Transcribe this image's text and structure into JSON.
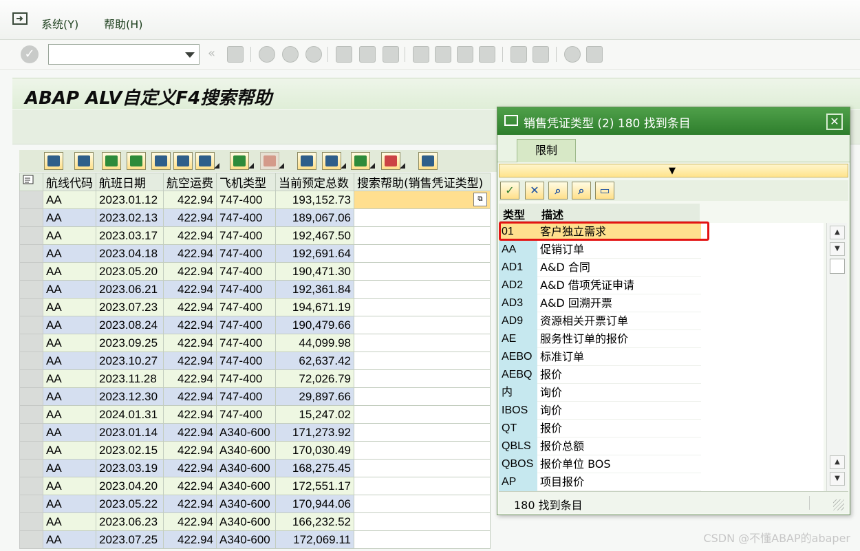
{
  "menubar": {
    "items": [
      {
        "label": "系统(Y)"
      },
      {
        "label": "帮助(H)"
      }
    ]
  },
  "toolbar": {
    "command_field": {
      "value": "",
      "placeholder": ""
    }
  },
  "title": "ABAP ALV自定义F4搜索帮助",
  "grid": {
    "columns": [
      "航线代码",
      "航班日期",
      "航空运费",
      "飞机类型",
      "当前预定总数",
      "搜索帮助(销售凭证类型)"
    ],
    "rows": [
      [
        "AA",
        "2023.01.12",
        "422.94",
        "747-400",
        "193,152.73",
        ""
      ],
      [
        "AA",
        "2023.02.13",
        "422.94",
        "747-400",
        "189,067.06",
        ""
      ],
      [
        "AA",
        "2023.03.17",
        "422.94",
        "747-400",
        "192,467.50",
        ""
      ],
      [
        "AA",
        "2023.04.18",
        "422.94",
        "747-400",
        "192,691.64",
        ""
      ],
      [
        "AA",
        "2023.05.20",
        "422.94",
        "747-400",
        "190,471.30",
        ""
      ],
      [
        "AA",
        "2023.06.21",
        "422.94",
        "747-400",
        "192,361.84",
        ""
      ],
      [
        "AA",
        "2023.07.23",
        "422.94",
        "747-400",
        "194,671.19",
        ""
      ],
      [
        "AA",
        "2023.08.24",
        "422.94",
        "747-400",
        "190,479.66",
        ""
      ],
      [
        "AA",
        "2023.09.25",
        "422.94",
        "747-400",
        "44,099.98",
        ""
      ],
      [
        "AA",
        "2023.10.27",
        "422.94",
        "747-400",
        "62,637.42",
        ""
      ],
      [
        "AA",
        "2023.11.28",
        "422.94",
        "747-400",
        "72,026.79",
        ""
      ],
      [
        "AA",
        "2023.12.30",
        "422.94",
        "747-400",
        "29,897.66",
        ""
      ],
      [
        "AA",
        "2024.01.31",
        "422.94",
        "747-400",
        "15,247.02",
        ""
      ],
      [
        "AA",
        "2023.01.14",
        "422.94",
        "A340-600",
        "171,273.92",
        ""
      ],
      [
        "AA",
        "2023.02.15",
        "422.94",
        "A340-600",
        "170,030.49",
        ""
      ],
      [
        "AA",
        "2023.03.19",
        "422.94",
        "A340-600",
        "168,275.45",
        ""
      ],
      [
        "AA",
        "2023.04.20",
        "422.94",
        "A340-600",
        "172,551.17",
        ""
      ],
      [
        "AA",
        "2023.05.22",
        "422.94",
        "A340-600",
        "170,944.06",
        ""
      ],
      [
        "AA",
        "2023.06.23",
        "422.94",
        "A340-600",
        "166,232.52",
        ""
      ],
      [
        "AA",
        "2023.07.25",
        "422.94",
        "A340-600",
        "172,069.11",
        ""
      ]
    ]
  },
  "popup": {
    "title": "销售凭证类型 (2)  180 找到条目",
    "tab_label": "限制",
    "filter_icon": "▼",
    "headers": {
      "type": "类型",
      "desc": "描述"
    },
    "items": [
      {
        "type": "01",
        "desc": "客户独立需求"
      },
      {
        "type": "AA",
        "desc": "促销订单"
      },
      {
        "type": "AD1",
        "desc": "A&D 合同"
      },
      {
        "type": "AD2",
        "desc": "A&D 借项凭证申请"
      },
      {
        "type": "AD3",
        "desc": "A&D 回溯开票"
      },
      {
        "type": "AD9",
        "desc": "资源相关开票订单"
      },
      {
        "type": "AE",
        "desc": "服务性订单的报价"
      },
      {
        "type": "AEBO",
        "desc": "标准订单"
      },
      {
        "type": "AEBQ",
        "desc": "报价"
      },
      {
        "type": "内",
        "desc": "询价"
      },
      {
        "type": "IBOS",
        "desc": "询价"
      },
      {
        "type": "QT",
        "desc": "报价"
      },
      {
        "type": "QBLS",
        "desc": "报价总额"
      },
      {
        "type": "QBOS",
        "desc": "报价单位 BOS"
      },
      {
        "type": "AP",
        "desc": "项目报价"
      }
    ],
    "footer": "180 找到条目"
  },
  "watermark": "CSDN @不懂ABAP的abaper",
  "colors": {
    "title_green": "#2e7e2c",
    "highlight": "#ffe08e",
    "key_col": "#c6e8ef",
    "row_alt_green": "#eef7e2",
    "row_alt_blue": "#d5dff0",
    "red_box": "#e31313"
  }
}
